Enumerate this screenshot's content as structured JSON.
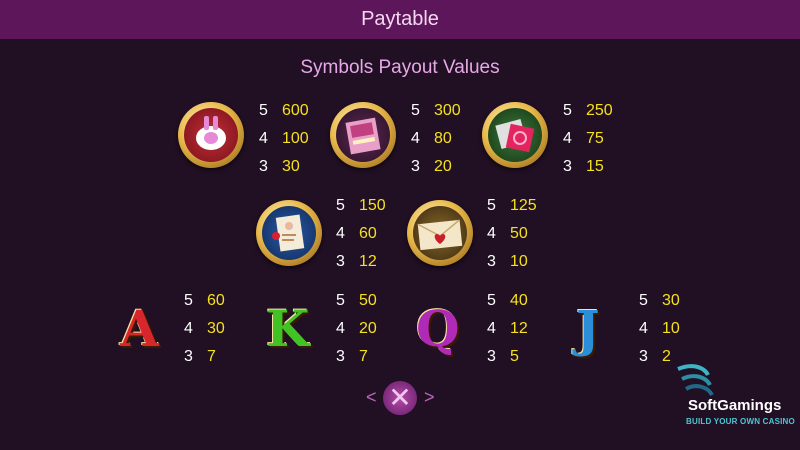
{
  "header": {
    "title": "Paytable"
  },
  "subtitle": "Symbols Payout Values",
  "premium_symbols": [
    {
      "icon": "vibrator-symbol-icon",
      "pays": [
        {
          "count": "5",
          "value": "600"
        },
        {
          "count": "4",
          "value": "100"
        },
        {
          "count": "3",
          "value": "30"
        }
      ]
    },
    {
      "icon": "magazine-symbol-icon",
      "pays": [
        {
          "count": "5",
          "value": "300"
        },
        {
          "count": "4",
          "value": "80"
        },
        {
          "count": "3",
          "value": "20"
        }
      ]
    },
    {
      "icon": "condom-symbol-icon",
      "pays": [
        {
          "count": "5",
          "value": "250"
        },
        {
          "count": "4",
          "value": "75"
        },
        {
          "count": "3",
          "value": "15"
        }
      ]
    },
    {
      "icon": "business-card-symbol-icon",
      "pays": [
        {
          "count": "5",
          "value": "150"
        },
        {
          "count": "4",
          "value": "60"
        },
        {
          "count": "3",
          "value": "12"
        }
      ]
    },
    {
      "icon": "love-letter-symbol-icon",
      "pays": [
        {
          "count": "5",
          "value": "125"
        },
        {
          "count": "4",
          "value": "50"
        },
        {
          "count": "3",
          "value": "10"
        }
      ]
    }
  ],
  "letter_symbols": [
    {
      "letter": "A",
      "color": "#d8262d",
      "pays": [
        {
          "count": "5",
          "value": "60"
        },
        {
          "count": "4",
          "value": "30"
        },
        {
          "count": "3",
          "value": "7"
        }
      ]
    },
    {
      "letter": "K",
      "color": "#41c225",
      "pays": [
        {
          "count": "5",
          "value": "50"
        },
        {
          "count": "4",
          "value": "20"
        },
        {
          "count": "3",
          "value": "7"
        }
      ]
    },
    {
      "letter": "Q",
      "color": "#b02ab8",
      "pays": [
        {
          "count": "5",
          "value": "40"
        },
        {
          "count": "4",
          "value": "12"
        },
        {
          "count": "3",
          "value": "5"
        }
      ]
    },
    {
      "letter": "J",
      "color": "#2a8fd8",
      "pays": [
        {
          "count": "5",
          "value": "30"
        },
        {
          "count": "4",
          "value": "10"
        },
        {
          "count": "3",
          "value": "2"
        }
      ]
    }
  ],
  "controls": {
    "close_symbol": "✕",
    "prev_symbol": "<",
    "next_symbol": ">"
  },
  "brand": {
    "name": "SoftGamings",
    "tagline": "BUILD YOUR OWN CASINO"
  },
  "colors": {
    "header_bg": "#5d1659",
    "background": "#210f24",
    "payout_value": "#f5e11e",
    "subtitle": "#e6a9e6"
  }
}
